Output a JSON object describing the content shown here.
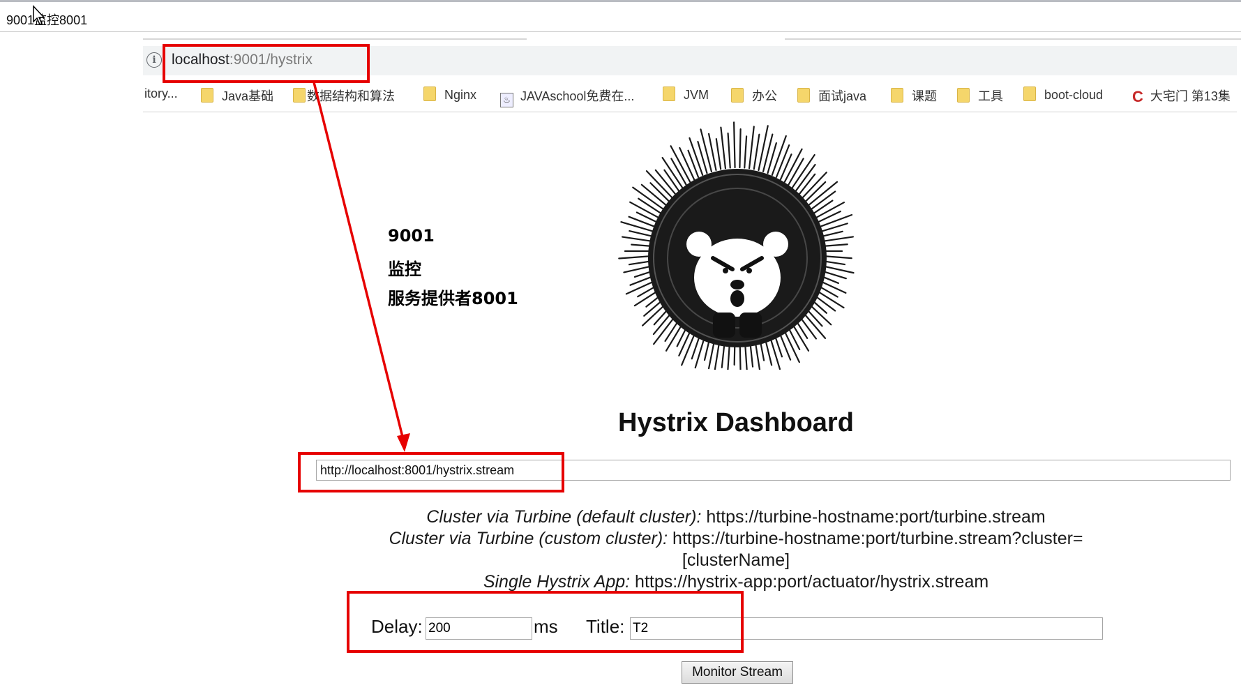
{
  "window": {
    "title": "9001监控8001"
  },
  "address_bar": {
    "host": "localhost",
    "path": ":9001/hystrix"
  },
  "bookmarks": [
    {
      "label": "itory...",
      "icon": "none"
    },
    {
      "label": "Java基础",
      "icon": "folder-icon"
    },
    {
      "label": "数据结构和算法",
      "icon": "folder-icon"
    },
    {
      "label": "Nginx",
      "icon": "folder-icon"
    },
    {
      "label": "JAVAschool免费在...",
      "icon": "page-icon"
    },
    {
      "label": "JVM",
      "icon": "folder-icon"
    },
    {
      "label": "办公",
      "icon": "folder-icon"
    },
    {
      "label": "面试java",
      "icon": "folder-icon"
    },
    {
      "label": "课题",
      "icon": "folder-icon"
    },
    {
      "label": "工具",
      "icon": "folder-icon"
    },
    {
      "label": "boot-cloud",
      "icon": "folder-icon"
    },
    {
      "label": "大宅门 第13集",
      "icon": "c-logo-icon"
    }
  ],
  "annotation": {
    "line1": "9001",
    "line2": "监控",
    "line3": "服务提供者8001",
    "color": "#e60000"
  },
  "dashboard": {
    "title": "Hystrix Dashboard",
    "stream_url": "http://localhost:8001/hystrix.stream",
    "help": {
      "turbine_default_label": "Cluster via Turbine (default cluster):",
      "turbine_default_url": "https://turbine-hostname:port/turbine.stream",
      "turbine_custom_label": "Cluster via Turbine (custom cluster):",
      "turbine_custom_url": "https://turbine-hostname:port/turbine.stream?cluster=",
      "turbine_custom_url_2": "[clusterName]",
      "single_label": "Single Hystrix App:",
      "single_url": "https://hystrix-app:port/actuator/hystrix.stream"
    },
    "delay_label": "Delay:",
    "delay_value": "200",
    "ms_label": "ms",
    "title_label": "Title:",
    "title_value": "T2",
    "monitor_button": "Monitor Stream"
  }
}
